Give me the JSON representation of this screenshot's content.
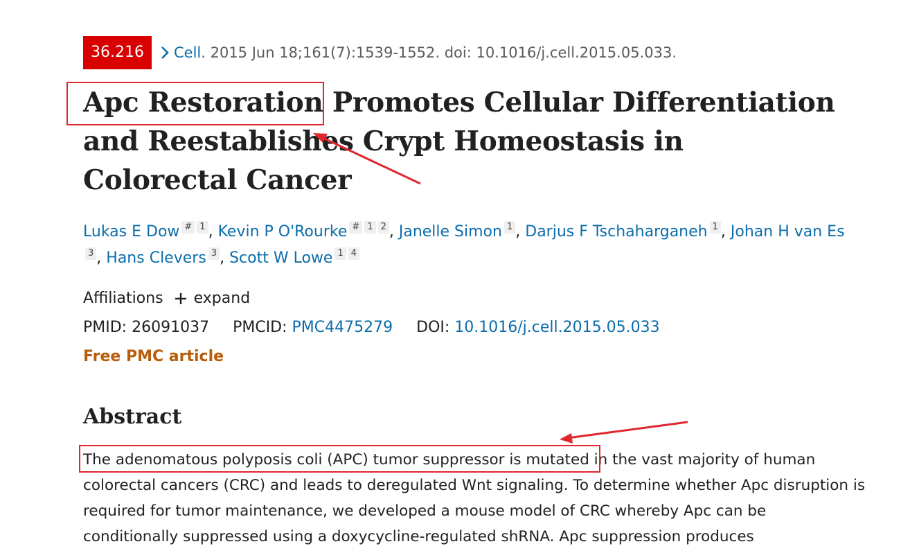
{
  "citation": {
    "impact_factor": "36.216",
    "journal": "Cell",
    "details": ". 2015 Jun 18;161(7):1539-1552. doi: 10.1016/j.cell.2015.05.033."
  },
  "title": "Apc Restoration Promotes Cellular Differentiation and Reestablishes Crypt Homeostasis in Colorectal Cancer",
  "authors": [
    {
      "name": "Lukas E Dow",
      "sups": [
        "#",
        "1"
      ]
    },
    {
      "name": "Kevin P O'Rourke",
      "sups": [
        "#",
        "1",
        "2"
      ]
    },
    {
      "name": "Janelle Simon",
      "sups": [
        "1"
      ]
    },
    {
      "name": "Darjus F Tschaharganeh",
      "sups": [
        "1"
      ]
    },
    {
      "name": "Johan H van Es",
      "sups": [
        "3"
      ]
    },
    {
      "name": "Hans Clevers",
      "sups": [
        "3"
      ]
    },
    {
      "name": "Scott W Lowe",
      "sups": [
        "1",
        "4"
      ]
    }
  ],
  "affiliations": {
    "label": "Affiliations",
    "expand_label": "expand",
    "icon": "plus-icon"
  },
  "identifiers": {
    "pmid_label": "PMID:",
    "pmid": "26091037",
    "pmcid_label": "PMCID:",
    "pmcid": "PMC4475279",
    "doi_label": "DOI:",
    "doi": "10.1016/j.cell.2015.05.033"
  },
  "free_pmc_label": "Free PMC article",
  "abstract": {
    "heading": "Abstract",
    "text": "The adenomatous polyposis coli (APC) tumor suppressor is mutated in the vast majority of human colorectal cancers (CRC) and leads to deregulated Wnt signaling. To determine whether Apc disruption is required for tumor maintenance, we developed a mouse model of CRC whereby Apc can be conditionally suppressed using a doxycycline-regulated shRNA. Apc suppression produces"
  },
  "colors": {
    "link": "#0b6dab",
    "badge": "#d80000",
    "free_article": "#b85d0a",
    "annotation": "#e0262e"
  }
}
